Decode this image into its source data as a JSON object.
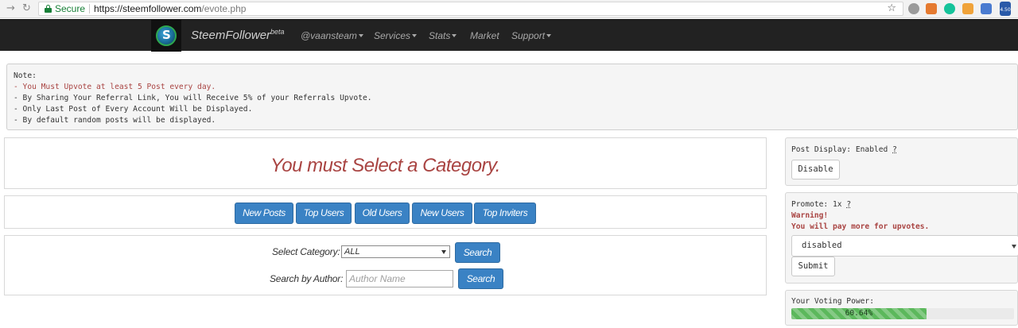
{
  "browser": {
    "secure_label": "Secure",
    "url_host": "https://steemfollower.com",
    "url_path": "/evote.php",
    "ext_badge": "4.50"
  },
  "navbar": {
    "brand": "SteemFollower",
    "brand_sup": "beta",
    "menu": [
      {
        "label": "@vaansteam",
        "caret": true
      },
      {
        "label": "Services",
        "caret": true
      },
      {
        "label": "Stats",
        "caret": true
      },
      {
        "label": "Market",
        "caret": false
      },
      {
        "label": "Support",
        "caret": true
      }
    ]
  },
  "note": {
    "heading": "Note:",
    "lines": [
      "- You Must Upvote at least 5 Post every day.",
      "- By Sharing Your Referral Link, You will Receive 5% of your Referrals Upvote.",
      "- Only Last Post of Every Account Will be Displayed.",
      "- By default random posts will be displayed."
    ]
  },
  "main": {
    "message": "You must Select a Category.",
    "filters": [
      "New Posts",
      "Top Users",
      "Old Users",
      "New Users",
      "Top Inviters"
    ],
    "select_category_label": "Select Category:",
    "category_value": "ALL",
    "search_button": "Search",
    "search_author_label": "Search by Author:",
    "author_placeholder": "Author Name",
    "search_button_2": "Search"
  },
  "sidebar": {
    "post_display_label": "Post Display: Enabled",
    "help_mark": "?",
    "disable_button": "Disable",
    "promote_label": "Promote: 1x",
    "warning_title": "Warning!",
    "warning_text": "You will pay more for upvotes.",
    "promote_value": "disabled",
    "submit_button": "Submit",
    "voting_power_label": "Your Voting Power:",
    "voting_power_text": "60.64%",
    "voting_power_pct": 60.64
  },
  "colors": {
    "navbar_bg": "#222222",
    "accent_blue": "#3a82c4",
    "warning_red": "#a94442",
    "progress_green": "#5cb85c"
  }
}
